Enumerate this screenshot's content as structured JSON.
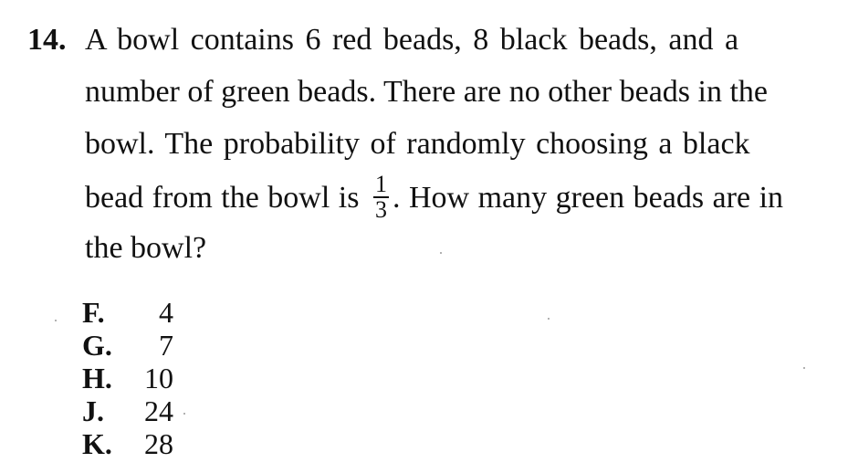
{
  "question": {
    "number": "14.",
    "lines": [
      "A bowl contains 6 red beads, 8 black beads, and a",
      "number of green beads. There are no other beads in the",
      "bowl. The probability of randomly choosing a black",
      "How many green beads are in",
      "the bowl?"
    ],
    "line4_before": "bead from the bowl is",
    "fraction": {
      "numerator": "1",
      "denominator": "3"
    },
    "line4_after": ". How many green beads are in"
  },
  "choices": [
    {
      "letter": "F.",
      "value": "4"
    },
    {
      "letter": "G.",
      "value": "7"
    },
    {
      "letter": "H.",
      "value": "10"
    },
    {
      "letter": "J.",
      "value": "24"
    },
    {
      "letter": "K.",
      "value": "28"
    }
  ]
}
